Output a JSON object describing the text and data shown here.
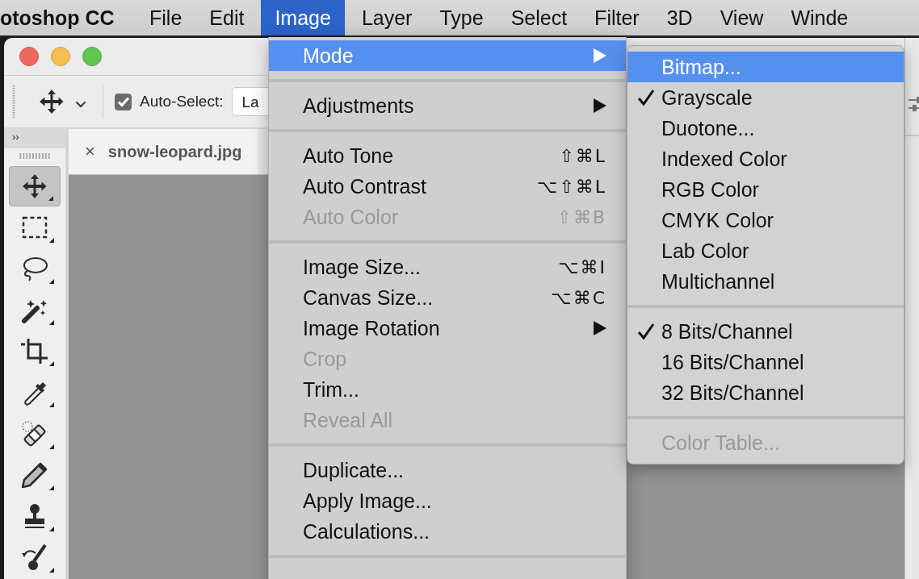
{
  "menubar": {
    "app_name": "otoshop CC",
    "items": [
      {
        "label": "File",
        "selected": false
      },
      {
        "label": "Edit",
        "selected": false
      },
      {
        "label": "Image",
        "selected": true
      },
      {
        "label": "Layer",
        "selected": false
      },
      {
        "label": "Type",
        "selected": false
      },
      {
        "label": "Select",
        "selected": false
      },
      {
        "label": "Filter",
        "selected": false
      },
      {
        "label": "3D",
        "selected": false
      },
      {
        "label": "View",
        "selected": false
      },
      {
        "label": "Winde",
        "selected": false
      }
    ]
  },
  "options_bar": {
    "auto_select": {
      "label": "Auto-Select:",
      "checked": true
    },
    "target_dropdown": {
      "value": "La"
    }
  },
  "toolbar": {
    "expand_toggle": "››",
    "tools": [
      {
        "kind": "move",
        "selected": true
      },
      {
        "kind": "marquee",
        "selected": false
      },
      {
        "kind": "lasso",
        "selected": false
      },
      {
        "kind": "wand",
        "selected": false
      },
      {
        "kind": "crop",
        "selected": false
      },
      {
        "kind": "eyedropper",
        "selected": false
      },
      {
        "kind": "healing",
        "selected": false
      },
      {
        "kind": "pencil",
        "selected": false
      },
      {
        "kind": "stamp",
        "selected": false
      },
      {
        "kind": "history_brush",
        "selected": false
      }
    ]
  },
  "document_tab": {
    "close": "×",
    "title": "snow-leopard.jpg"
  },
  "image_menu": {
    "items": [
      {
        "kind": "item",
        "label": "Mode",
        "submenu": true,
        "selected": true,
        "disabled": false
      },
      {
        "kind": "separator"
      },
      {
        "kind": "item",
        "label": "Adjustments",
        "submenu": true,
        "selected": false,
        "disabled": false
      },
      {
        "kind": "separator"
      },
      {
        "kind": "item",
        "label": "Auto Tone",
        "shortcut": "⇧⌘L",
        "selected": false,
        "disabled": false
      },
      {
        "kind": "item",
        "label": "Auto Contrast",
        "shortcut": "⌥⇧⌘L",
        "selected": false,
        "disabled": false
      },
      {
        "kind": "item",
        "label": "Auto Color",
        "shortcut": "⇧⌘B",
        "selected": false,
        "disabled": true
      },
      {
        "kind": "separator"
      },
      {
        "kind": "item",
        "label": "Image Size...",
        "shortcut": "⌥⌘I",
        "selected": false,
        "disabled": false
      },
      {
        "kind": "item",
        "label": "Canvas Size...",
        "shortcut": "⌥⌘C",
        "selected": false,
        "disabled": false
      },
      {
        "kind": "item",
        "label": "Image Rotation",
        "submenu": true,
        "selected": false,
        "disabled": false
      },
      {
        "kind": "item",
        "label": "Crop",
        "selected": false,
        "disabled": true
      },
      {
        "kind": "item",
        "label": "Trim...",
        "selected": false,
        "disabled": false
      },
      {
        "kind": "item",
        "label": "Reveal All",
        "selected": false,
        "disabled": true
      },
      {
        "kind": "separator"
      },
      {
        "kind": "item",
        "label": "Duplicate...",
        "selected": false,
        "disabled": false
      },
      {
        "kind": "item",
        "label": "Apply Image...",
        "selected": false,
        "disabled": false
      },
      {
        "kind": "item",
        "label": "Calculations...",
        "selected": false,
        "disabled": false
      },
      {
        "kind": "separator"
      }
    ]
  },
  "mode_submenu": {
    "items": [
      {
        "kind": "item",
        "label": "Bitmap...",
        "checked": false,
        "selected": true,
        "disabled": false
      },
      {
        "kind": "item",
        "label": "Grayscale",
        "checked": true,
        "selected": false,
        "disabled": false
      },
      {
        "kind": "item",
        "label": "Duotone...",
        "checked": false,
        "selected": false,
        "disabled": false
      },
      {
        "kind": "item",
        "label": "Indexed Color",
        "checked": false,
        "selected": false,
        "disabled": false
      },
      {
        "kind": "item",
        "label": "RGB Color",
        "checked": false,
        "selected": false,
        "disabled": false
      },
      {
        "kind": "item",
        "label": "CMYK Color",
        "checked": false,
        "selected": false,
        "disabled": false
      },
      {
        "kind": "item",
        "label": "Lab Color",
        "checked": false,
        "selected": false,
        "disabled": false
      },
      {
        "kind": "item",
        "label": "Multichannel",
        "checked": false,
        "selected": false,
        "disabled": false
      },
      {
        "kind": "separator"
      },
      {
        "kind": "item",
        "label": "8 Bits/Channel",
        "checked": true,
        "selected": false,
        "disabled": false
      },
      {
        "kind": "item",
        "label": "16 Bits/Channel",
        "checked": false,
        "selected": false,
        "disabled": false
      },
      {
        "kind": "item",
        "label": "32 Bits/Channel",
        "checked": false,
        "selected": false,
        "disabled": false
      },
      {
        "kind": "separator"
      },
      {
        "kind": "item",
        "label": "Color Table...",
        "checked": false,
        "selected": false,
        "disabled": true
      }
    ]
  }
}
